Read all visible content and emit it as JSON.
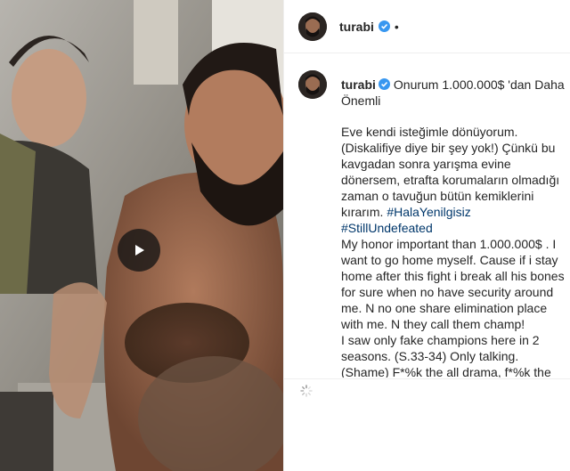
{
  "post": {
    "username": "turabi",
    "header_separator": "•",
    "verified_icon": "verified-badge-icon",
    "colors": {
      "verified": "#3897f0",
      "hashtag": "#00376b",
      "text": "#262626",
      "divider": "#efefef"
    }
  },
  "media": {
    "type": "video",
    "play_icon": "play-icon"
  },
  "caption": {
    "title": "Onurum 1.000.000$ 'dan Daha Önemli",
    "turkish_text": "Eve kendi isteğimle dönüyorum. (Diskalifiye diye bir şey yok!) Çünkü bu kavgadan sonra yarışma evine dönersem, etrafta korumaların olmadığı zaman o tavuğun bütün kemiklerini kırarım.",
    "hashtags": [
      "#HalaYenilgisiz",
      "#StillUndefeated"
    ],
    "english_1": "My honor important than 1.000.000$ . I want to go home myself. Cause if i stay home after this fight i break all his bones for sure when no have security around me. N no one share elimination place with me. N they call them champ!",
    "english_2": "I saw only fake champions here in 2 seasons. (S.33-34) Only talking.",
    "english_3_cut": "(Shame) F*%k the all drama, f*%k the all"
  }
}
